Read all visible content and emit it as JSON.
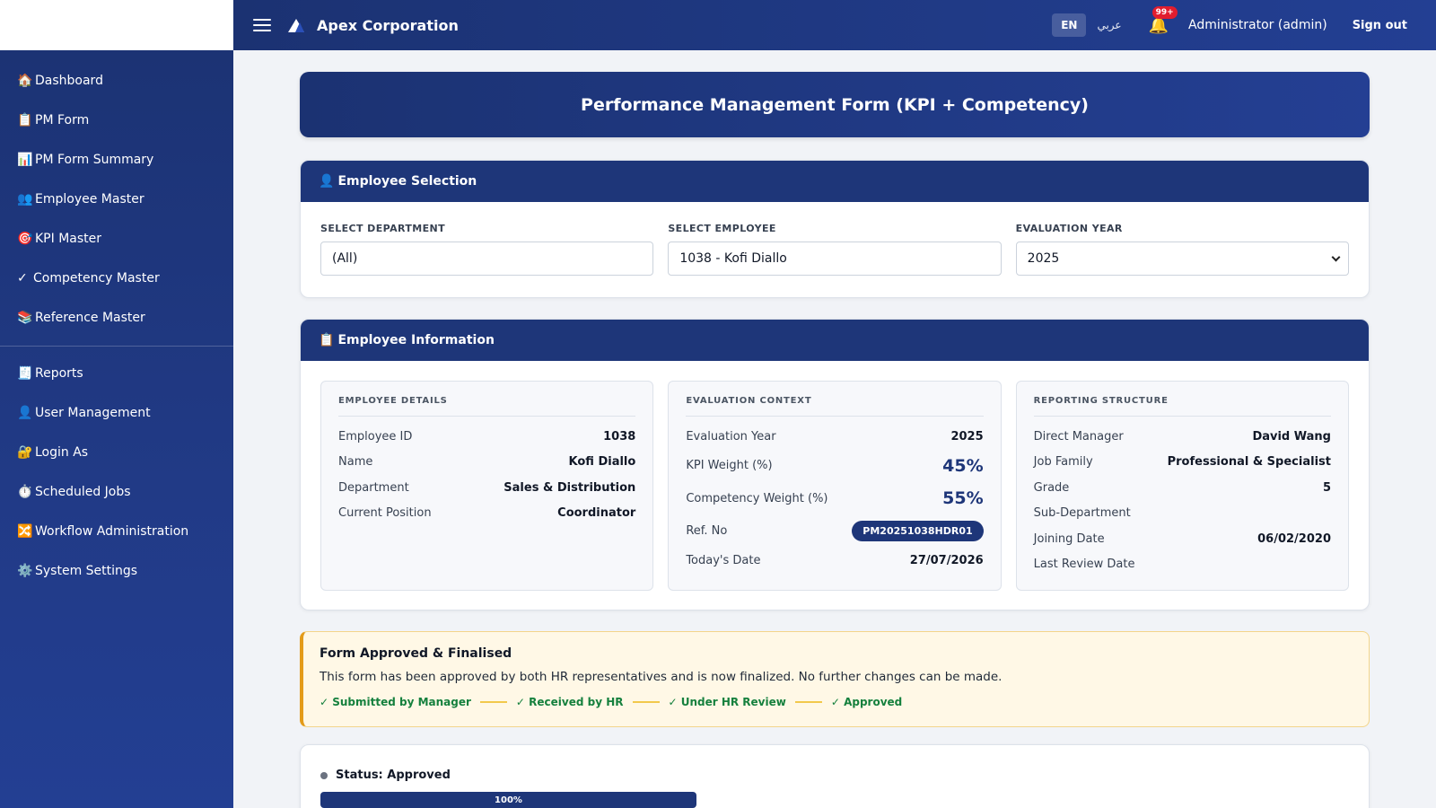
{
  "app": {
    "name": "Apex Corporation",
    "user": "Administrator (admin)",
    "signout": "Sign out",
    "lang_en": "EN",
    "lang_ar": "عربي",
    "notif_badge": "99+"
  },
  "sidebar": {
    "items": [
      {
        "icon": "🏠",
        "label": "Dashboard"
      },
      {
        "icon": "📋",
        "label": "PM Form"
      },
      {
        "icon": "📊",
        "label": "PM Form Summary"
      },
      {
        "icon": "👥",
        "label": "Employee Master"
      },
      {
        "icon": "🎯",
        "label": "KPI Master"
      },
      {
        "icon": "✓",
        "label": "Competency Master"
      },
      {
        "icon": "📚",
        "label": "Reference Master"
      },
      {
        "icon": "🧾",
        "label": "Reports"
      },
      {
        "icon": "👤",
        "label": "User Management"
      },
      {
        "icon": "🔐",
        "label": "Login As"
      },
      {
        "icon": "⏱️",
        "label": "Scheduled Jobs"
      },
      {
        "icon": "🔀",
        "label": "Workflow Administration"
      },
      {
        "icon": "⚙️",
        "label": "System Settings"
      }
    ]
  },
  "page": {
    "title": "Performance Management Form (KPI + Competency)"
  },
  "selection": {
    "header": "Employee Selection",
    "header_icon": "👤",
    "department": {
      "label": "SELECT DEPARTMENT",
      "value": "(All)"
    },
    "employee": {
      "label": "SELECT EMPLOYEE",
      "value": "1038 - Kofi Diallo"
    },
    "year": {
      "label": "EVALUATION YEAR",
      "value": "2025"
    }
  },
  "info": {
    "header": "Employee Information",
    "header_icon": "📋",
    "details": {
      "title": "EMPLOYEE DETAILS",
      "employee_id": {
        "label": "Employee ID",
        "value": "1038"
      },
      "name": {
        "label": "Name",
        "value": "Kofi Diallo"
      },
      "department": {
        "label": "Department",
        "value": "Sales & Distribution"
      },
      "position": {
        "label": "Current Position",
        "value": "Coordinator"
      }
    },
    "context": {
      "title": "EVALUATION CONTEXT",
      "year": {
        "label": "Evaluation Year",
        "value": "2025"
      },
      "kpi_weight": {
        "label": "KPI Weight (%)",
        "value": "45%"
      },
      "comp_weight": {
        "label": "Competency Weight (%)",
        "value": "55%"
      },
      "ref_no": {
        "label": "Ref. No",
        "value": "PM20251038HDR01"
      },
      "today": {
        "label": "Today's Date",
        "value": "27/07/2026"
      }
    },
    "reporting": {
      "title": "REPORTING STRUCTURE",
      "manager": {
        "label": "Direct Manager",
        "value": "David Wang"
      },
      "job_family": {
        "label": "Job Family",
        "value": "Professional & Specialist"
      },
      "grade": {
        "label": "Grade",
        "value": "5"
      },
      "sub_dept": {
        "label": "Sub-Department",
        "value": ""
      },
      "joining": {
        "label": "Joining Date",
        "value": "06/02/2020"
      },
      "last_review": {
        "label": "Last Review Date",
        "value": ""
      }
    }
  },
  "notice": {
    "title": "Form Approved & Finalised",
    "text": "This form has been approved by both HR representatives and is now finalized. No further changes can be made.",
    "steps": [
      "✓ Submitted by Manager",
      "✓ Received by HR",
      "✓ Under HR Review",
      "✓ Approved"
    ]
  },
  "status": {
    "label": "Status: Approved",
    "progress": 100,
    "progress_label": "100%"
  }
}
